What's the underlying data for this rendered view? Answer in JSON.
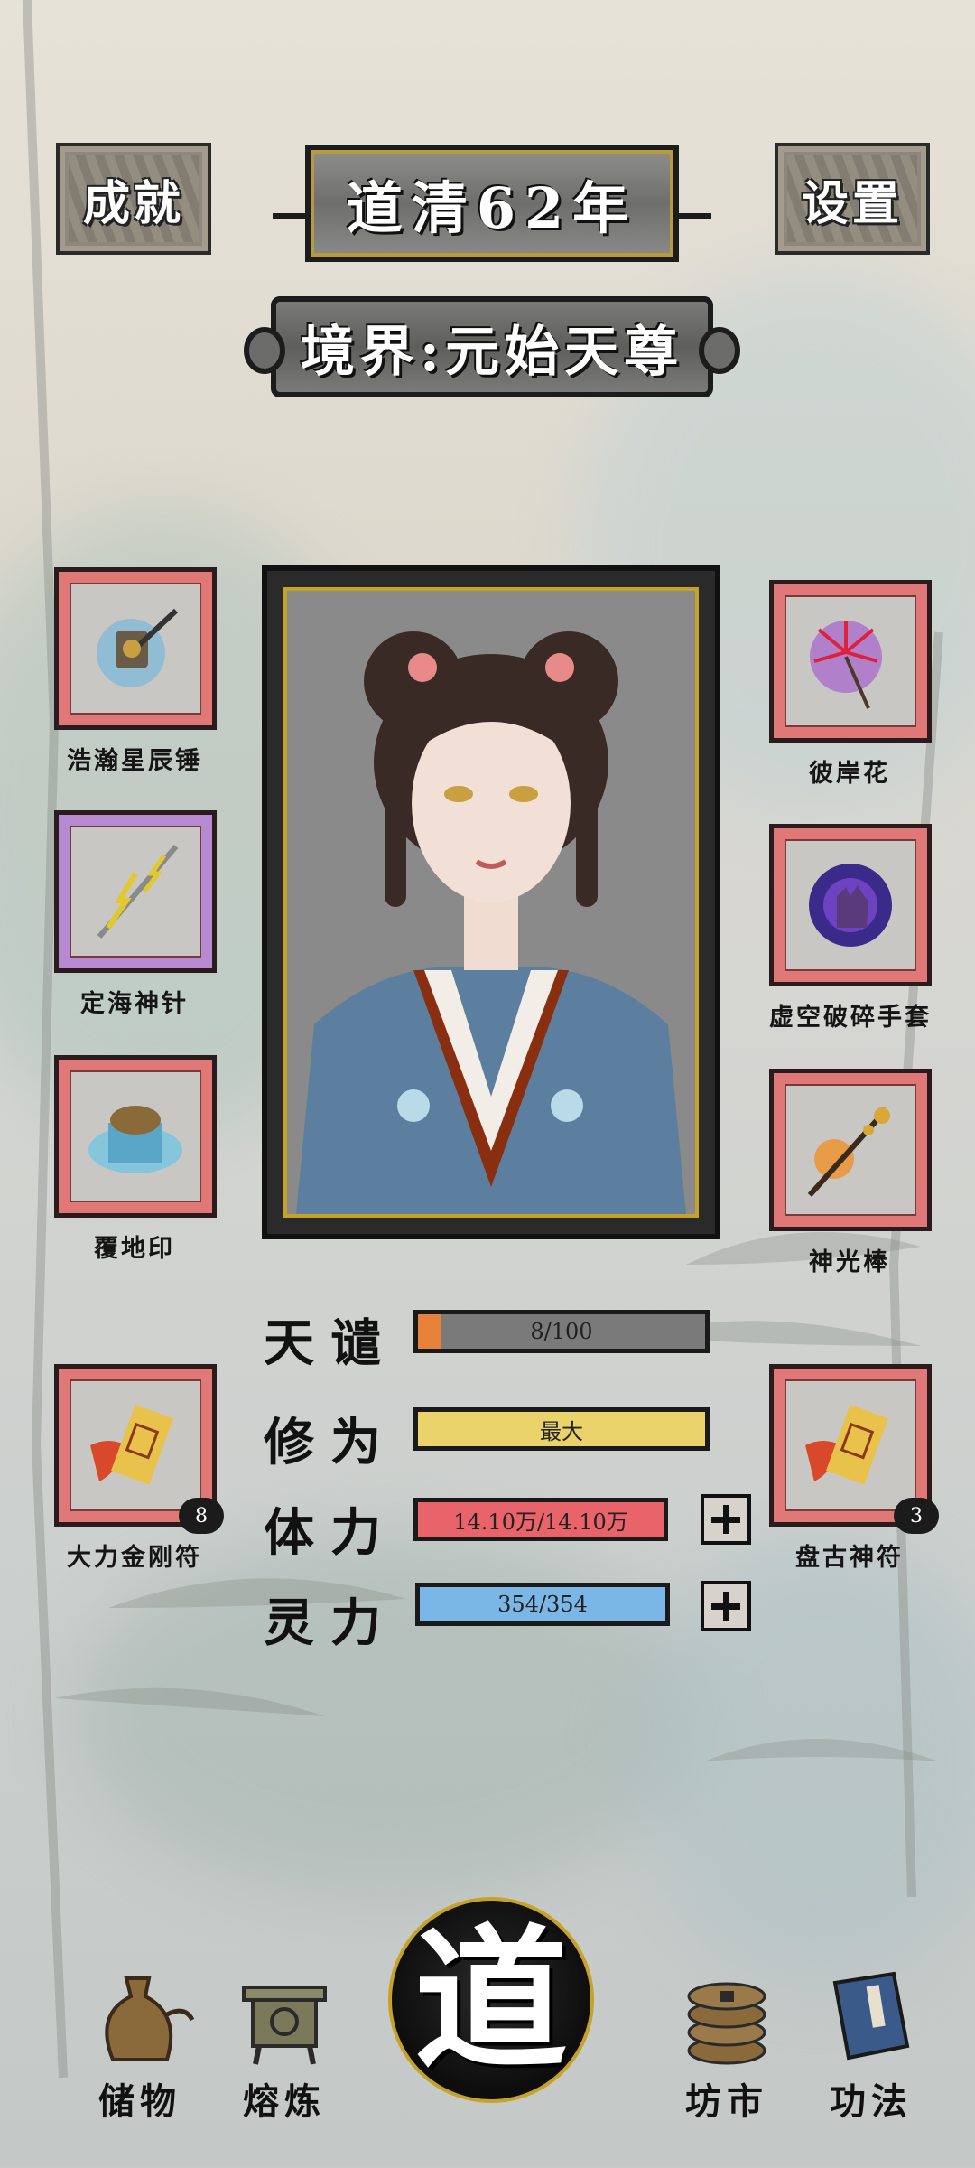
{
  "header": {
    "achievements_label": "成就",
    "settings_label": "设置",
    "year_label": "道清62年",
    "realm_label": "境界:元始天尊"
  },
  "left_items": [
    {
      "name": "浩瀚星辰锤",
      "frame_color": "#e07878"
    },
    {
      "name": "定海神针",
      "frame_color": "#b68ad0"
    },
    {
      "name": "覆地印",
      "frame_color": "#e07878"
    },
    {
      "name": "大力金刚符",
      "frame_color": "#e07878",
      "count": "8"
    }
  ],
  "right_items": [
    {
      "name": "彼岸花",
      "frame_color": "#e07878"
    },
    {
      "name": "虚空破碎手套",
      "frame_color": "#e07878"
    },
    {
      "name": "神光棒",
      "frame_color": "#e07878"
    },
    {
      "name": "盘古神符",
      "frame_color": "#e07878",
      "count": "3"
    }
  ],
  "stats": {
    "tianqian": {
      "label": "天谴",
      "value": "8/100",
      "fraction": 0.08,
      "color": "#e8823a"
    },
    "xiuwei": {
      "label": "修为",
      "value": "最大",
      "fraction": 1.0,
      "color": "#e9d36a"
    },
    "tili": {
      "label": "体力",
      "value": "14.10万/14.10万",
      "fraction": 1.0,
      "color": "#e8636a"
    },
    "lingli": {
      "label": "灵力",
      "value": "354/354",
      "fraction": 1.0,
      "color": "#7ab7e6"
    }
  },
  "nav": {
    "storage": "储物",
    "smelt": "熔炼",
    "dao": "道",
    "market": "坊市",
    "skills": "功法"
  }
}
